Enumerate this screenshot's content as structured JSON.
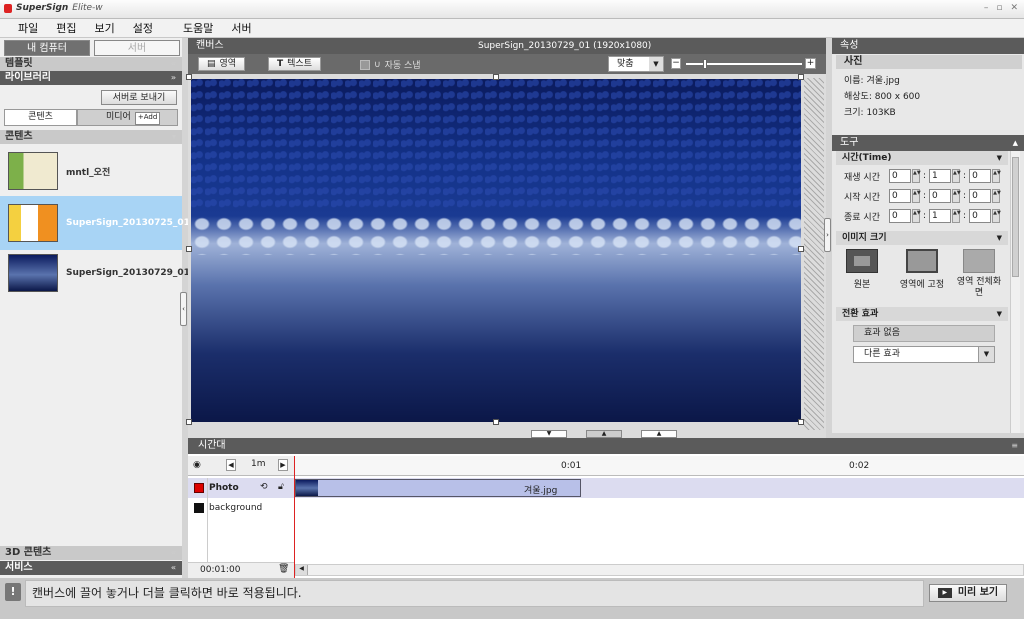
{
  "app": {
    "logo": "SuperSign",
    "edition": "Elite-w"
  },
  "menu": [
    "파일",
    "편집",
    "보기",
    "설정",
    "도움말",
    "서버"
  ],
  "left": {
    "tabs": [
      "내 컴퓨터",
      "서버"
    ],
    "templates": "템플릿",
    "library": "라이브러리",
    "send_server": "서버로 보내기",
    "subtabs": [
      "콘텐츠",
      "미디어"
    ],
    "add": "+Add",
    "contents_header": "콘텐츠",
    "items": [
      "mntl_오전",
      "SuperSign_20130725_01",
      "SuperSign_20130729_01"
    ],
    "contents3d": "3D 콘텐츠",
    "service": "서비스"
  },
  "canvas": {
    "header": "캔버스",
    "title": "SuperSign_20130729_01 (1920x1080)",
    "area_btn": "영역",
    "text_btn": "텍스트",
    "snap": "자동 스냅",
    "fit": "맞춤"
  },
  "props": {
    "header": "속성",
    "photo": "사진",
    "name": "이름: 겨울.jpg",
    "resolution": "해상도: 800 x 600",
    "size": "크기: 103KB",
    "tools": "도구",
    "time_header": "시간(Time)",
    "rows": [
      {
        "label": "재생 시간",
        "v": [
          "0",
          "1",
          "0"
        ]
      },
      {
        "label": "시작 시간",
        "v": [
          "0",
          "0",
          "0"
        ]
      },
      {
        "label": "종료 시간",
        "v": [
          "0",
          "1",
          "0"
        ]
      }
    ],
    "image_size": "이미지 크기",
    "sizes": [
      "원본",
      "영역에 고정",
      "영역 전체화면"
    ],
    "transition": "전환 효과",
    "no_effect": "효과 없음",
    "more_effect": "다른 효과"
  },
  "timeline": {
    "header": "시간대",
    "zoom": "1m",
    "marks": [
      "0:01",
      "0:02"
    ],
    "layers": [
      "Photo",
      "background"
    ],
    "clip": "겨울.jpg",
    "time": "00:01:00"
  },
  "status": {
    "message": "캔버스에 끌어 놓거나 더블 클릭하면 바로 적용됩니다.",
    "preview": "미리 보기"
  }
}
